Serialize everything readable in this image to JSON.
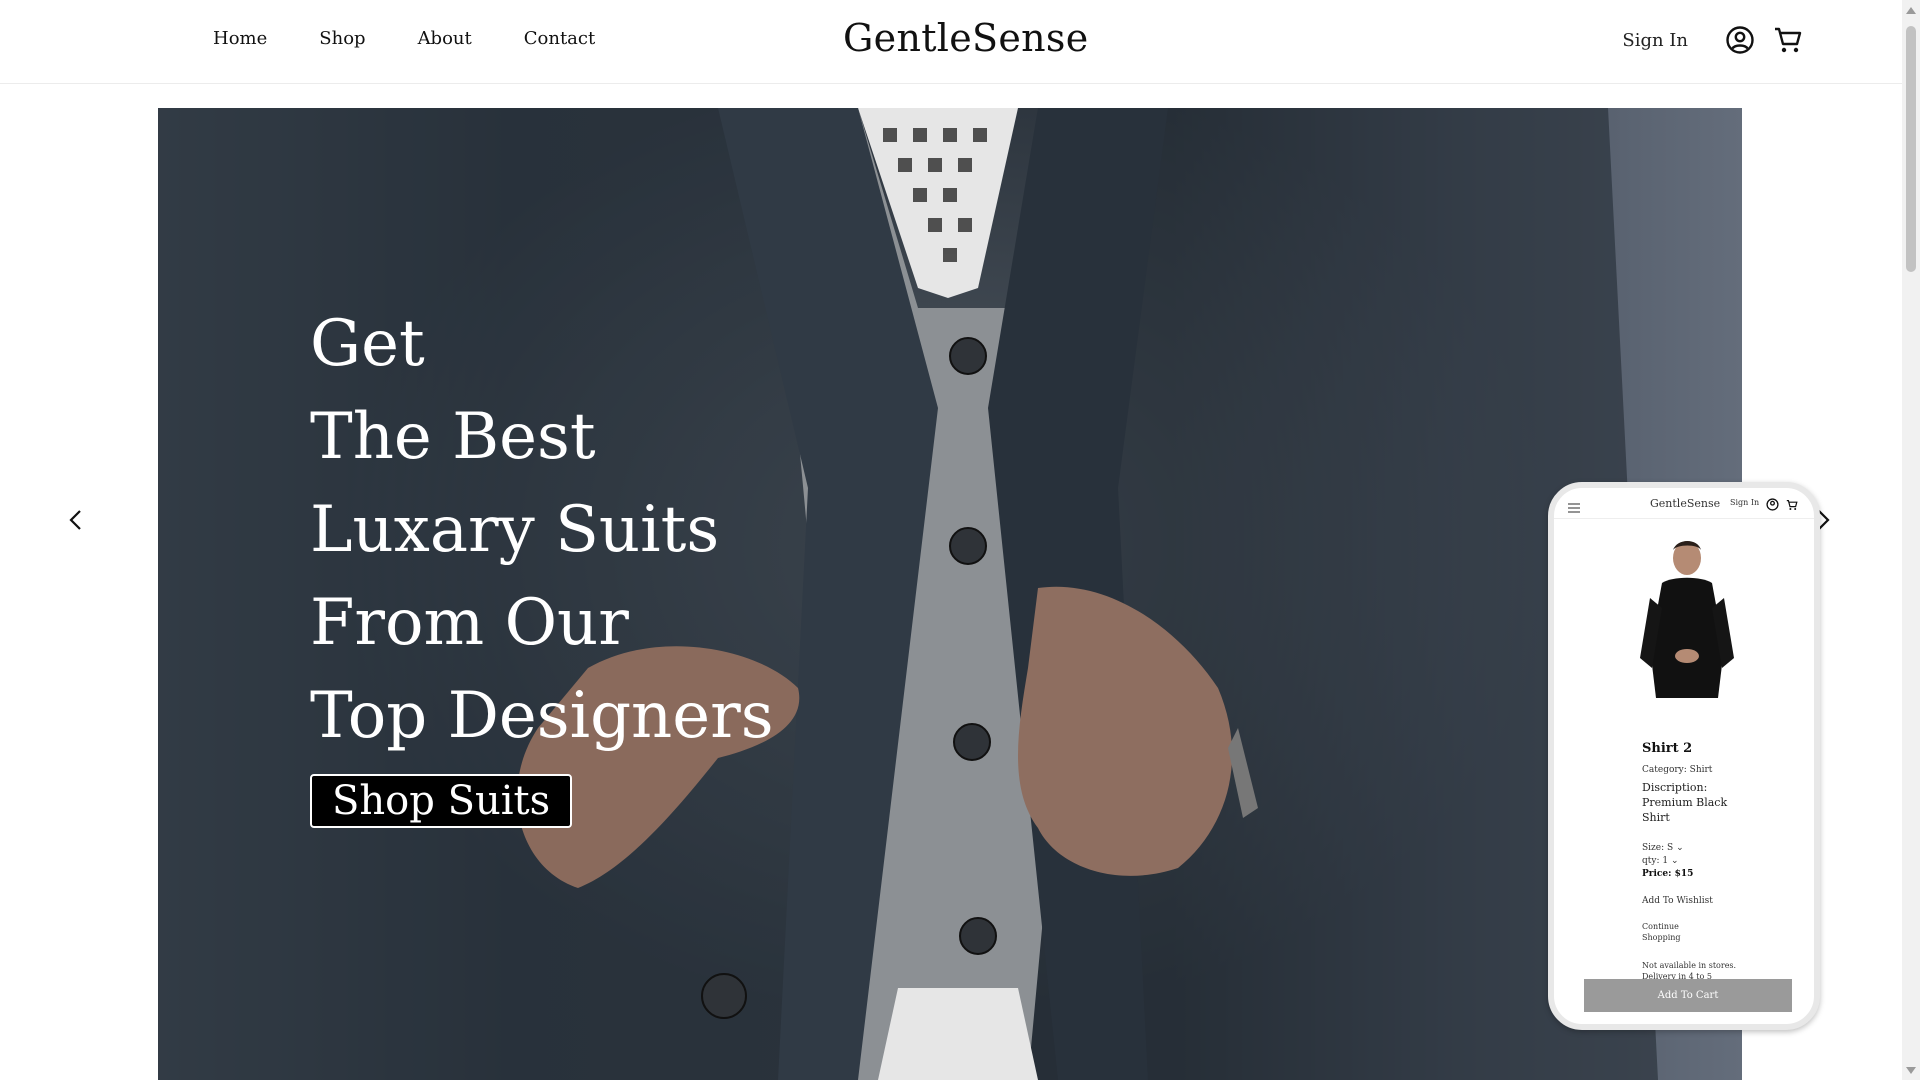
{
  "header": {
    "nav": [
      "Home",
      "Shop",
      "About",
      "Contact"
    ],
    "brand": "GentleSense",
    "sign_in": "Sign In",
    "icons": [
      "user-circle-icon",
      "cart-icon"
    ]
  },
  "hero": {
    "headline": [
      "Get",
      "The Best",
      "Luxary Suits",
      "From Our",
      "Top Designers"
    ],
    "cta": "Shop Suits",
    "arrows": [
      "chevron-left-icon",
      "chevron-right-icon"
    ]
  },
  "phone_preview": {
    "brand": "GentleSense",
    "sign_in": "Sign In",
    "product_title": "Shirt 2",
    "category": "Category: Shirt",
    "description": "Discription: Premium Black Shirt",
    "size_label": "Size:",
    "size_value": "S",
    "qty_label": "qty:",
    "qty_value": "1",
    "price": "Price: $15",
    "wishlist": "Add To Wishlist",
    "continue": "Continue Shopping",
    "note": "Not available in stores. Delivery in 4 to 5",
    "add_to_cart": "Add To Cart"
  }
}
